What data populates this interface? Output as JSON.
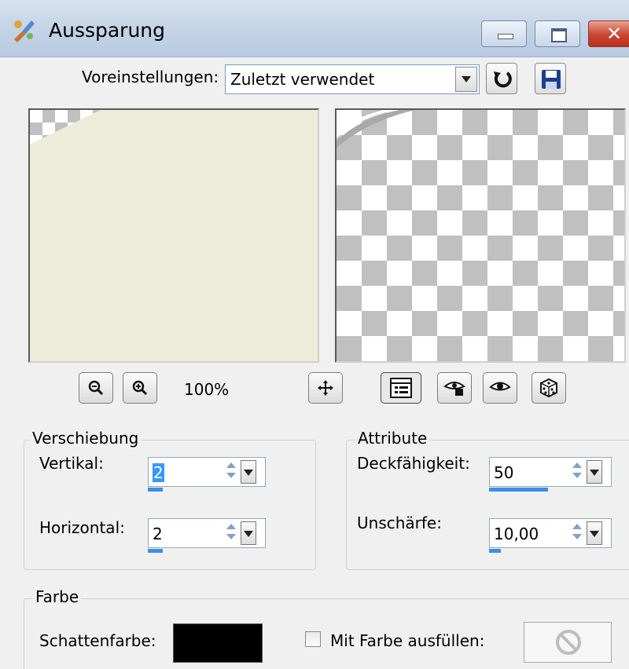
{
  "window": {
    "title": "Aussparung"
  },
  "presets": {
    "label": "Voreinstellungen:",
    "selected": "Zuletzt verwendet"
  },
  "zoom": {
    "level": "100%"
  },
  "offset_group": {
    "title": "Verschiebung",
    "vertical_label": "Vertikal:",
    "vertical_value": "2",
    "vertical_slider_pct": 0.2,
    "horizontal_label": "Horizontal:",
    "horizontal_value": "2",
    "horizontal_slider_pct": 0.2
  },
  "attributes_group": {
    "title": "Attribute",
    "opacity_label": "Deckfähigkeit:",
    "opacity_value": "50",
    "opacity_slider_pct": 0.5,
    "blur_label": "Unschärfe:",
    "blur_value": "10,00",
    "blur_slider_pct": 0.1
  },
  "color_group": {
    "title": "Farbe",
    "shadow_color_label": "Schattenfarbe:",
    "shadow_color": "#000000",
    "fill_checkbox_label": "Mit Farbe ausfüllen:",
    "fill_checked": false
  },
  "colors": {
    "titlebar": "#c3d3e6",
    "dialog_bg": "#f0f0f0",
    "preview_original": "#ebedd9",
    "slider_fill": "#3d8ee8",
    "selection": "#3399ff"
  },
  "icons": [
    "app-brush-icon",
    "minimize-icon",
    "maximize-icon",
    "close-icon",
    "reset-arrow-icon",
    "save-disk-icon",
    "zoom-out-icon",
    "zoom-in-icon",
    "pan-move-icon",
    "proof-toggle-icon",
    "eye-lock-icon",
    "eye-icon",
    "dice-randomize-icon",
    "no-fill-icon"
  ]
}
